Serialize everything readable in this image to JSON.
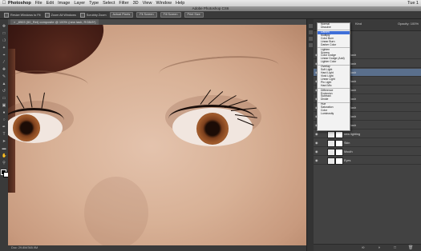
{
  "menubar": {
    "app": "Photoshop",
    "items": [
      "File",
      "Edit",
      "Image",
      "Layer",
      "Type",
      "Select",
      "Filter",
      "3D",
      "View",
      "Window",
      "Help"
    ],
    "clock": "Tue 1"
  },
  "window_title": "Adobe Photoshop CS6",
  "options_bar": {
    "checkbox1": "Resize Windows to Fit",
    "checkbox2": "Zoom All Windows",
    "checkbox3": "Scrubby Zoom",
    "btn1": "Actual Pixels",
    "btn2": "Fit Screen",
    "btn3": "Fill Screen",
    "btn4": "Print Size"
  },
  "document_tab": "_8903 (50_Ret) composite @ 100% (new lash, RGB/8*)",
  "status_text": "Doc: 29.8M/365.9M",
  "layers_panel": {
    "kind_label": "Kind",
    "opacity_label": "Opacity:",
    "opacity_value": "100%",
    "layers": [
      {
        "name": "new lash",
        "selected": false,
        "grouped": true
      },
      {
        "name": "new lash",
        "selected": false,
        "grouped": true
      },
      {
        "name": "new lash",
        "selected": true,
        "grouped": true
      },
      {
        "name": "new lash",
        "selected": false,
        "grouped": true
      },
      {
        "name": "new lash",
        "selected": false,
        "grouped": true
      },
      {
        "name": "new lash",
        "selected": false,
        "grouped": true
      },
      {
        "name": "new lash",
        "selected": false,
        "grouped": true
      },
      {
        "name": "new lash",
        "selected": false,
        "grouped": true
      },
      {
        "name": "new lash",
        "selected": false,
        "grouped": true
      },
      {
        "name": "new lighting",
        "selected": false,
        "grouped": false
      },
      {
        "name": "Skin",
        "selected": false,
        "grouped": false
      },
      {
        "name": "Mouth",
        "selected": false,
        "grouped": false
      },
      {
        "name": "Eyes",
        "selected": false,
        "grouped": false
      }
    ]
  },
  "blend_modes": {
    "groups": [
      [
        "Normal",
        "Dissolve"
      ],
      [
        "Darken",
        "Multiply",
        "Color Burn",
        "Linear Burn",
        "Darker Color"
      ],
      [
        "Lighten",
        "Screen",
        "Color Dodge",
        "Linear Dodge (Add)",
        "Lighter Color"
      ],
      [
        "Overlay",
        "Soft Light",
        "Hard Light",
        "Vivid Light",
        "Linear Light",
        "Pin Light",
        "Hard Mix"
      ],
      [
        "Difference",
        "Exclusion",
        "Subtract",
        "Divide"
      ],
      [
        "Hue",
        "Saturation",
        "Color",
        "Luminosity"
      ]
    ],
    "highlighted": "Darken"
  },
  "colors": {
    "selection": "#5a6f8c",
    "group_tag": "#7a5a9a",
    "menu_highlight": "#3f6fd8"
  }
}
